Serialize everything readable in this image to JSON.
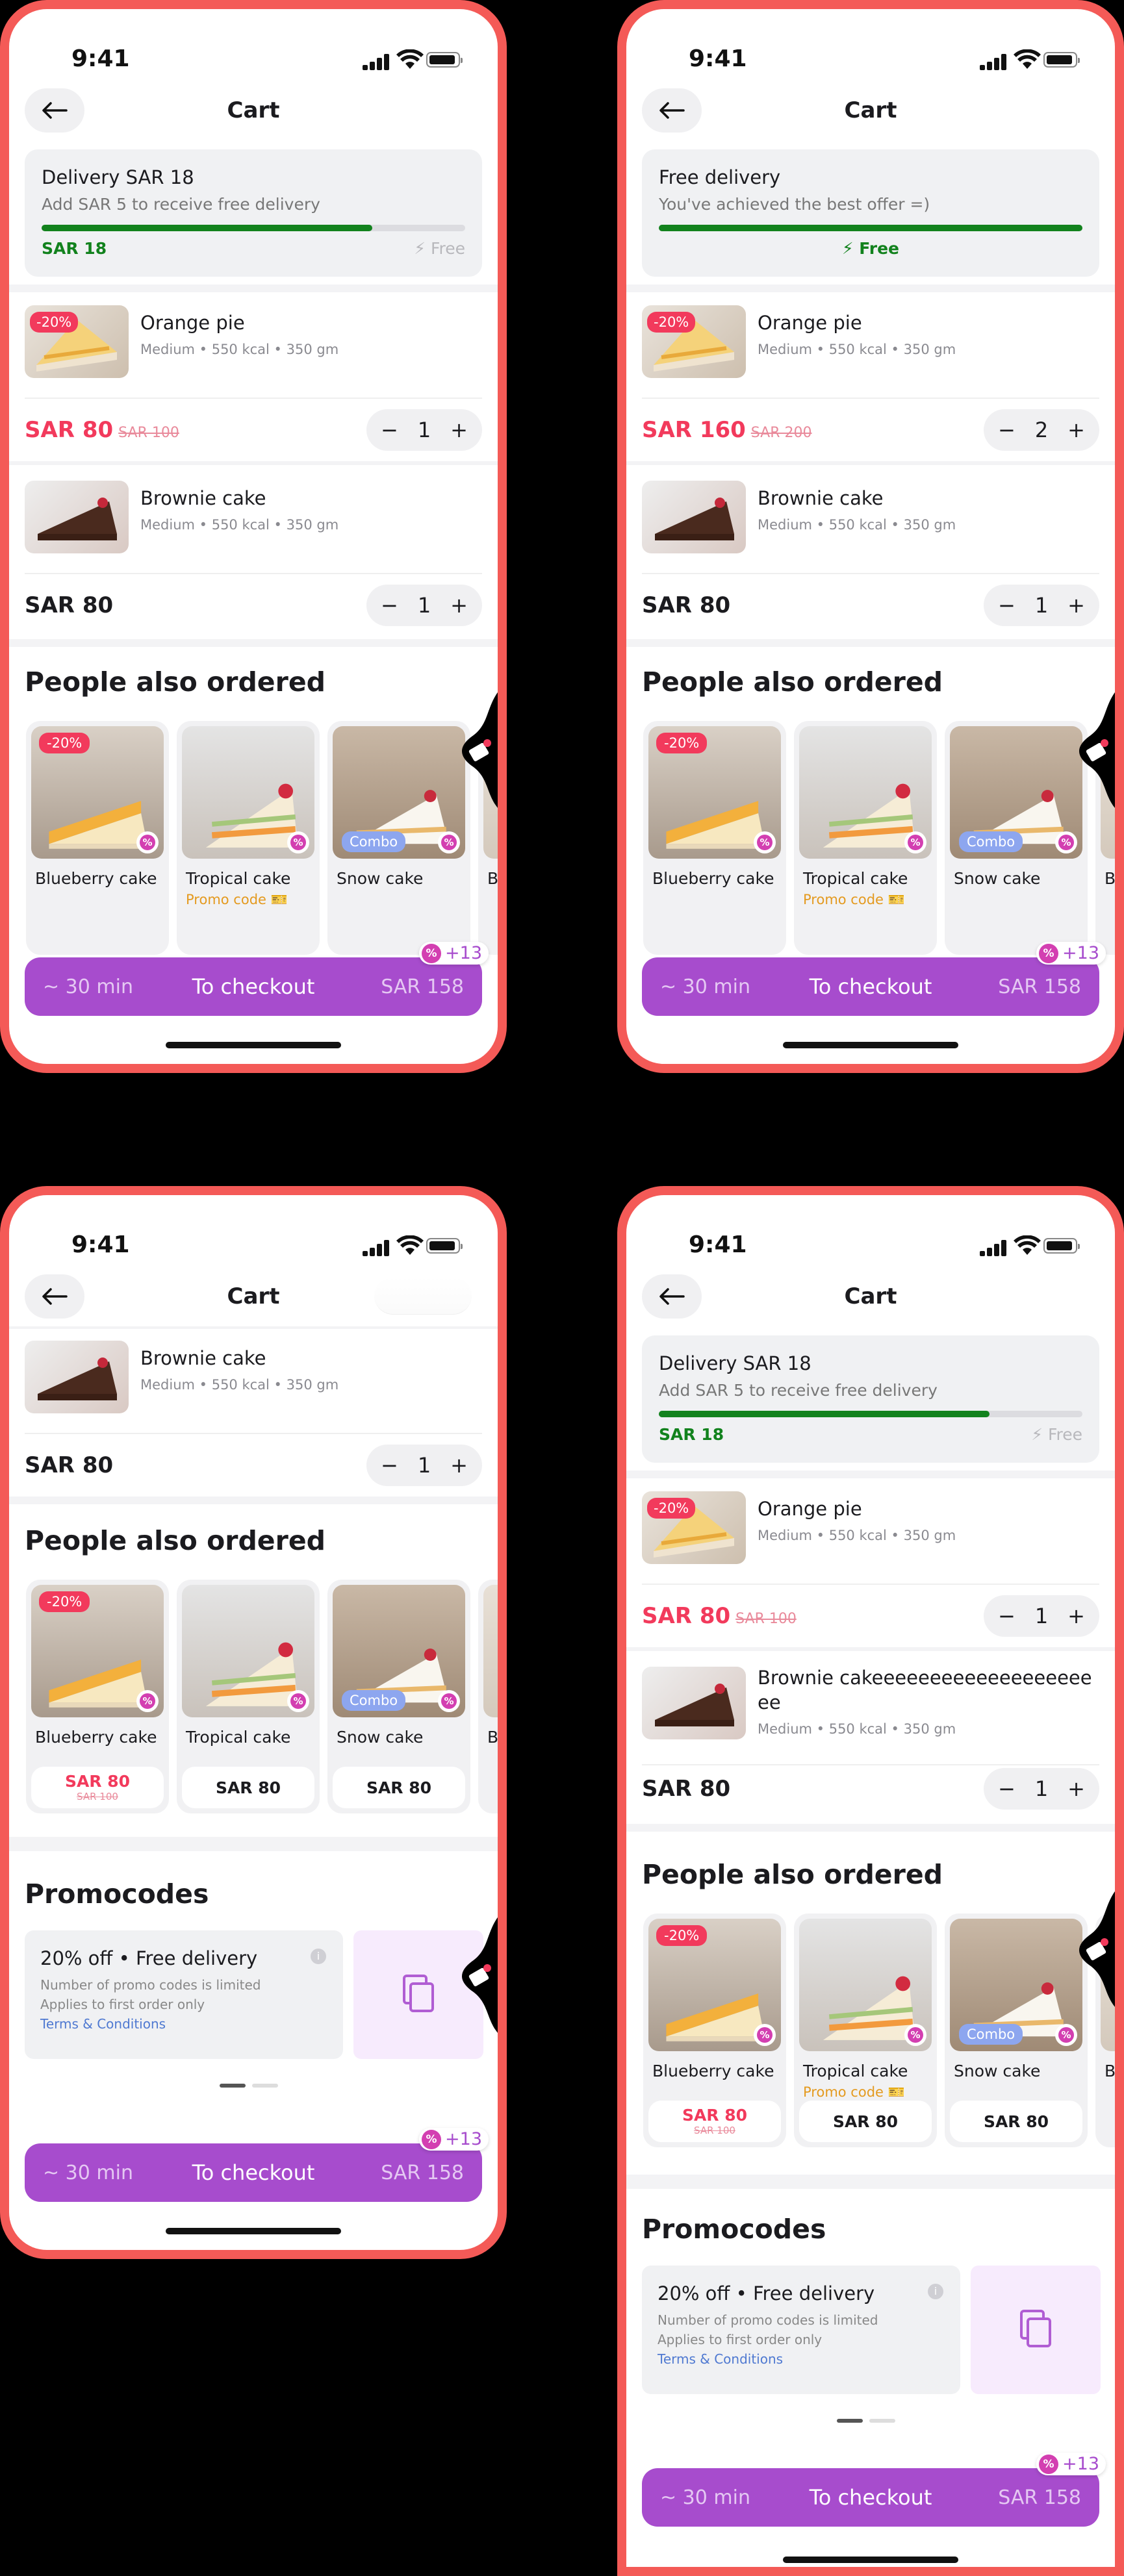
{
  "status": {
    "time": "9:41"
  },
  "header": {
    "title": "Cart"
  },
  "delivery_pending": {
    "title": "Delivery SAR 18",
    "subtitle": "Add SAR 5 to receive free delivery",
    "amount": "SAR 18",
    "free_label": "Free",
    "progress": 0.78
  },
  "delivery_free": {
    "title": "Free delivery",
    "subtitle": "You've achieved the best offer =)",
    "free_label": "Free",
    "progress": 1.0
  },
  "items": {
    "orange": {
      "name": "Orange pie",
      "desc": "Medium • 550 kcal • 350 gm",
      "badge": "-20%",
      "price": "SAR 80",
      "old_price": "SAR 100",
      "qty": "1"
    },
    "orange_double": {
      "price": "SAR 160",
      "old_price": "SAR 200",
      "qty": "2"
    },
    "brownie": {
      "name": "Brownie cake",
      "desc": "Medium • 550 kcal • 350 gm",
      "price": "SAR 80",
      "qty": "1"
    },
    "brownie_long": {
      "name": "Brownie cakeeeeeeeeeeeeeeeeeeeee"
    }
  },
  "stepper": {
    "minus": "−",
    "plus": "+"
  },
  "also_ordered": {
    "title": "People also ordered",
    "cards": [
      {
        "name": "Blueberry cake",
        "badge": "-20%",
        "price": "SAR 80",
        "old_price": "SAR 100"
      },
      {
        "name": "Tropical cake",
        "promo": "Promo code",
        "price": "SAR 80"
      },
      {
        "name": "Snow cake",
        "combo": "Combo",
        "price": "SAR 80"
      },
      {
        "name": "B"
      }
    ]
  },
  "promocodes": {
    "title": "Promocodes",
    "card_title": "20% off • Free delivery",
    "line1": "Number of promo codes is limited",
    "line2": "Applies to first order only",
    "link": "Terms & Conditions",
    "info": "i"
  },
  "checkout": {
    "time": "~ 30 min",
    "label": "To checkout",
    "total": "SAR 158",
    "badge_count": "+13"
  },
  "colors": {
    "frame": "#f45a57",
    "accent": "#a74ccd",
    "sale": "#f23a5c",
    "success": "#12821d"
  }
}
